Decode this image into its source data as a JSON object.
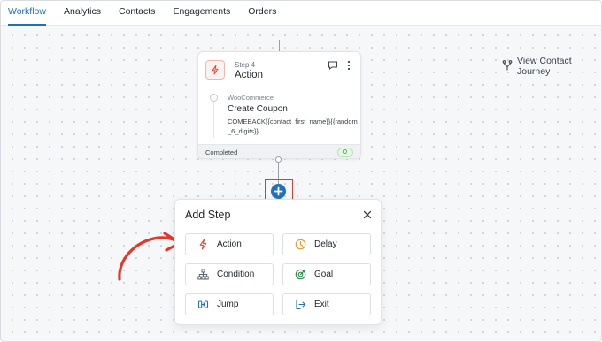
{
  "nav": {
    "tabs": [
      {
        "label": "Workflow",
        "active": true
      },
      {
        "label": "Analytics",
        "active": false
      },
      {
        "label": "Contacts",
        "active": false
      },
      {
        "label": "Engagements",
        "active": false
      },
      {
        "label": "Orders",
        "active": false
      }
    ]
  },
  "journey_link": {
    "label": "View Contact Journey",
    "icon": "fork-icon"
  },
  "step_card": {
    "step_label": "Step 4",
    "title": "Action",
    "icon": "lightning-icon",
    "integration": "WooCommerce",
    "action_name": "Create Coupon",
    "action_detail": "COMEBACK{{contact_first_name}}{{random_6_digits}}",
    "status": "Completed",
    "count": "0"
  },
  "add_step": {
    "title": "Add Step",
    "options": [
      {
        "label": "Action",
        "icon": "lightning-icon"
      },
      {
        "label": "Delay",
        "icon": "clock-icon"
      },
      {
        "label": "Condition",
        "icon": "branch-icon"
      },
      {
        "label": "Goal",
        "icon": "target-icon"
      },
      {
        "label": "Jump",
        "icon": "jump-icon"
      },
      {
        "label": "Exit",
        "icon": "exit-icon"
      }
    ]
  },
  "colors": {
    "accent": "#1f6fb2",
    "add_button": "#2371b8",
    "highlight_red": "#e03a2b",
    "completed_green": "#2e7d32"
  }
}
